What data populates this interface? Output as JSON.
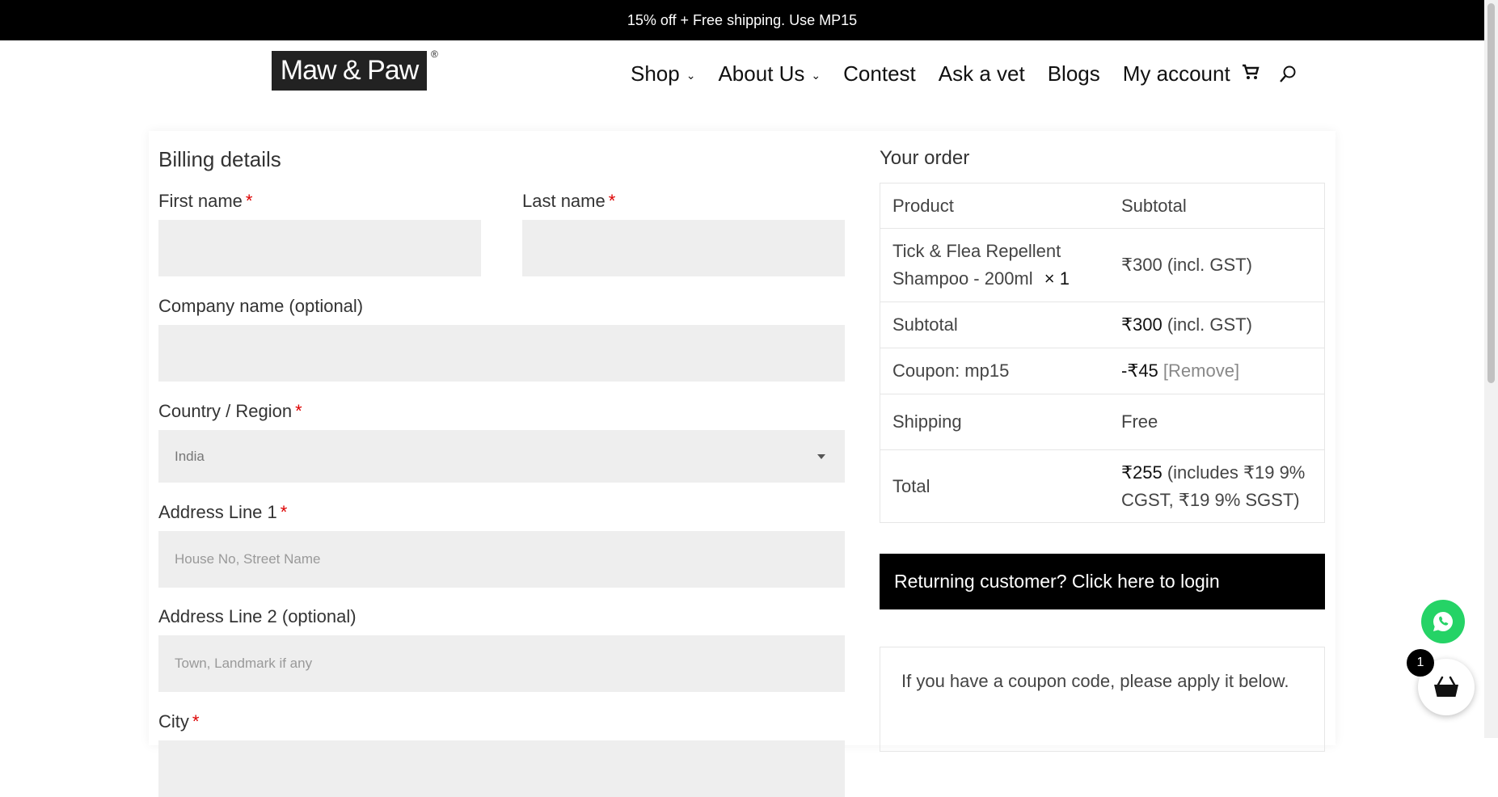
{
  "promo": {
    "text": "15% off + Free shipping. Use MP15"
  },
  "header": {
    "logo_text": "Maw & Paw",
    "logo_mark": "®",
    "nav": [
      "Shop",
      "About Us",
      "Contest",
      "Ask a vet",
      "Blogs",
      "My account"
    ]
  },
  "billing": {
    "title": "Billing details",
    "first_name_label": "First name",
    "last_name_label": "Last name",
    "company_label": "Company name (optional)",
    "country_label": "Country / Region",
    "country_value": "India",
    "address1_label": "Address Line 1",
    "address1_placeholder": "House No, Street Name",
    "address2_label": "Address Line 2 (optional)",
    "address2_placeholder": "Town, Landmark if any",
    "city_label": "City",
    "required_mark": "*"
  },
  "order": {
    "title": "Your order",
    "header_product": "Product",
    "header_subtotal": "Subtotal",
    "item_name": "Tick & Flea Repellent Shampoo - 200ml",
    "item_qty": "× 1",
    "item_price": "₹300",
    "item_tax": "(incl. GST)",
    "subtotal_label": "Subtotal",
    "subtotal_value": "₹300",
    "subtotal_tax": "(incl. GST)",
    "coupon_label": "Coupon: mp15",
    "coupon_value": "-₹45",
    "coupon_remove": "[Remove]",
    "shipping_label": "Shipping",
    "shipping_value": "Free",
    "total_label": "Total",
    "total_value": "₹255",
    "total_tax": "(includes ₹19 9% CGST, ₹19 9% SGST)"
  },
  "login_bar": {
    "text": "Returning customer? Click here to login"
  },
  "coupon_box": {
    "text": "If you have a coupon code, please apply it below."
  },
  "floating": {
    "cart_count": "1"
  },
  "colors": {
    "accent": "#000000",
    "required": "#dd0000",
    "field_bg": "#eeeeee",
    "whatsapp": "#25d366"
  }
}
